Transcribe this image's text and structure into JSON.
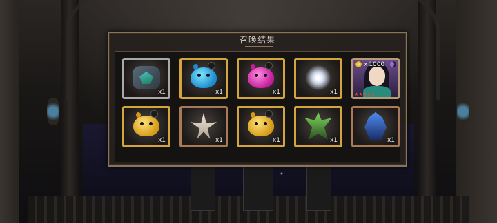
{
  "panel": {
    "title": "召唤结果"
  },
  "rewards": [
    {
      "name": "Jade Stone",
      "quantity": "x1",
      "frame": "silver",
      "art": "stone"
    },
    {
      "name": "Blue Slime",
      "quantity": "x1",
      "frame": "gold",
      "art": "blob-blue"
    },
    {
      "name": "Pink Slime",
      "quantity": "x1",
      "frame": "gold",
      "art": "blob-pink"
    },
    {
      "name": "White Crystal",
      "quantity": "x1",
      "frame": "gold",
      "art": "crystal"
    },
    {
      "name": "Hero Card",
      "quantity": "1000",
      "frame": "hero",
      "art": "hero",
      "stars": 5
    },
    {
      "name": "Gold Slime",
      "quantity": "x1",
      "frame": "gold",
      "art": "blob-gold"
    },
    {
      "name": "Star Relic",
      "quantity": "x1",
      "frame": "bronze",
      "art": "starburst"
    },
    {
      "name": "Gold Slime",
      "quantity": "x1",
      "frame": "gold",
      "art": "blob-gold"
    },
    {
      "name": "Green Relic",
      "quantity": "x1",
      "frame": "gold",
      "art": "relic-green"
    },
    {
      "name": "Blue Relic",
      "quantity": "x1",
      "frame": "bronze",
      "art": "relic-blue"
    }
  ],
  "hero_card": {
    "amount_prefix": "x",
    "amount": "1000"
  },
  "colors": {
    "gold_frame": "#d2a53e",
    "silver_frame": "#a9a9a6",
    "bronze_frame": "#a87a56",
    "panel_border": "#8a7458"
  }
}
